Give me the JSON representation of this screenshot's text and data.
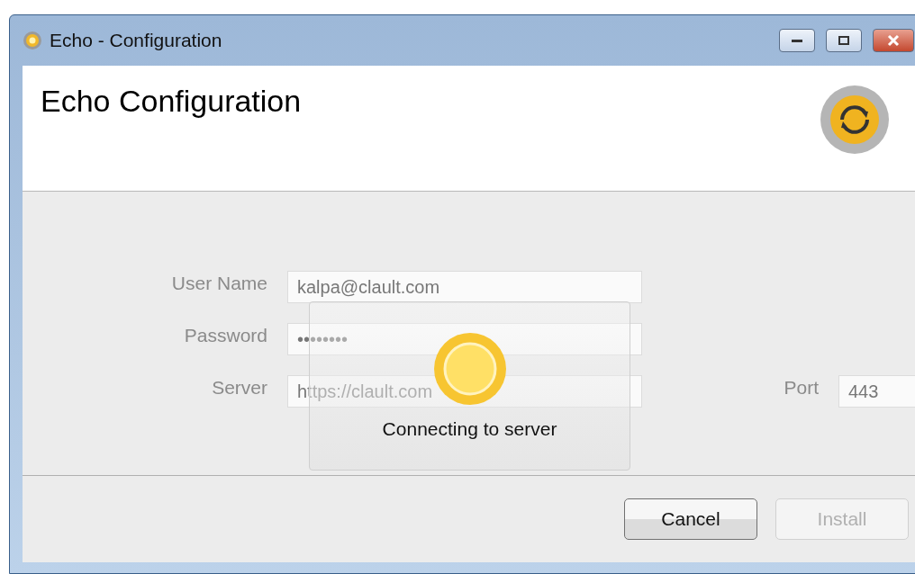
{
  "window": {
    "title": "Echo - Configuration"
  },
  "header": {
    "title": "Echo Configuration"
  },
  "form": {
    "fields": [
      {
        "label": "User Name",
        "value": "kalpa@clault.com",
        "disabled": true
      },
      {
        "label": "Password",
        "value": "••••••••",
        "disabled": true
      },
      {
        "label": "Server",
        "value": "https://clault.com",
        "disabled": true
      }
    ],
    "port": {
      "label": "Port",
      "value": "443",
      "disabled": true
    }
  },
  "progress": {
    "message": "Connecting to server"
  },
  "buttons": [
    {
      "label": "Cancel",
      "disabled": false
    },
    {
      "label": "Install",
      "disabled": true
    }
  ]
}
